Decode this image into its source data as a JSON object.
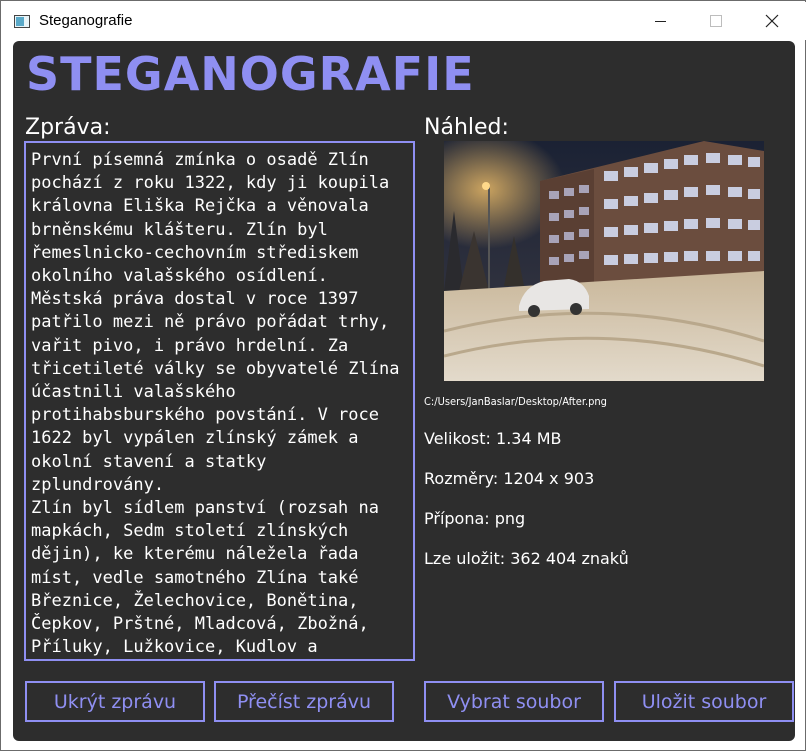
{
  "window": {
    "title": "Steganografie"
  },
  "app": {
    "heading": "STEGANOGRAFIE",
    "accent_color": "#8f8ff2",
    "background_color": "#2d2d2d"
  },
  "message": {
    "label": "Zpráva:",
    "text": "První písemná zmínka o osadě Zlín pochází z roku 1322, kdy ji koupila královna Eliška Rejčka a věnovala brněnskému klášteru. Zlín byl řemeslnicko-cechovním střediskem okolního valašského osídlení. Městská práva dostal v roce 1397  patřilo mezi ně právo pořádat trhy, vařit pivo, i právo hrdelní. Za třicetileté války se obyvatelé Zlína účastnili valašského protihabsburského povstání. V roce 1622 byl vypálen zlínský zámek a okolní stavení a statky zplundrovány.\nZlín byl sídlem panství (rozsah na mapkách, Sedm století zlínských dějin), ke kterému náležela řada míst, vedle samotného Zlína také Březnice, Želechovice, Bonětina, Čepkov, Prštné, Mladcová, Zbožná, Příluky, Lužkovice, Kudlov a"
  },
  "preview": {
    "label": "Náhled:",
    "file_path": "C:/Users/JanBaslar/Desktop/After.png",
    "size": "Velikost: 1.34 MB",
    "dimensions": "Rozměry: 1204 x 903",
    "extension": "Přípona: png",
    "capacity": "Lze uložit: 362 404 znaků"
  },
  "buttons": {
    "hide": "Ukrýt zprávu",
    "read": "Přečíst zprávu",
    "select": "Vybrat soubor",
    "save": "Uložit soubor"
  },
  "icons": {
    "app": "window-app-icon",
    "minimize": "minimize-icon",
    "maximize": "maximize-icon",
    "close": "close-icon"
  }
}
